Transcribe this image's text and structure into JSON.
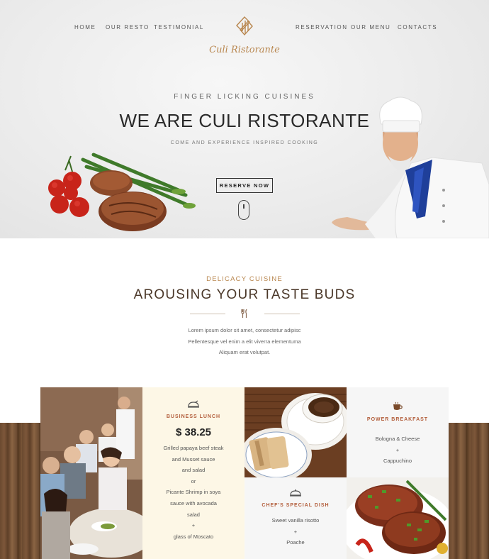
{
  "nav": {
    "left": [
      "HOME",
      "OUR RESTO",
      "TESTIMONIAL"
    ],
    "right": [
      "RESERVATION",
      "OUR MENU",
      "CONTACTS"
    ]
  },
  "logo": {
    "text": "Culi Ristorante"
  },
  "hero": {
    "subtitle": "FINGER LICKING CUISINES",
    "title": "WE ARE CULI RISTORANTE",
    "tagline": "COME AND EXPERIENCE INSPIRED COOKING",
    "button": "RESERVE NOW"
  },
  "intro": {
    "eyebrow": "DELICACY CUISINE",
    "title": "AROUSING YOUR TASTE BUDS",
    "lines": [
      "Lorem ipsum dolor sit amet, consectetur adipisc",
      "Pellentesque vel enim a elit viverra elementuma",
      "Aliquam erat volutpat."
    ]
  },
  "menu": {
    "business_lunch": {
      "title": "BUSINESS LUNCH",
      "price": "$ 38.25",
      "lines": [
        "Grilled papaya beef steak",
        "and Musset sauce",
        "and salad",
        "or",
        "Picante Shrimp in soya",
        "sauce with avocada",
        "salad",
        "+",
        "glass of Moscato"
      ]
    },
    "power_breakfast": {
      "title": "POWER BREAKFAST",
      "lines": [
        "Bologna & Cheese",
        "+",
        "Cappuchino"
      ]
    },
    "chefs_special": {
      "title": "CHEF'S SPECIAL DISH",
      "lines": [
        "Sweet vanilla risotto",
        "+",
        "Poache"
      ]
    }
  },
  "colors": {
    "accent": "#b8864e",
    "title_brown": "#4a3728",
    "card_title": "#b25d3a",
    "cream": "#fdf7e6"
  }
}
